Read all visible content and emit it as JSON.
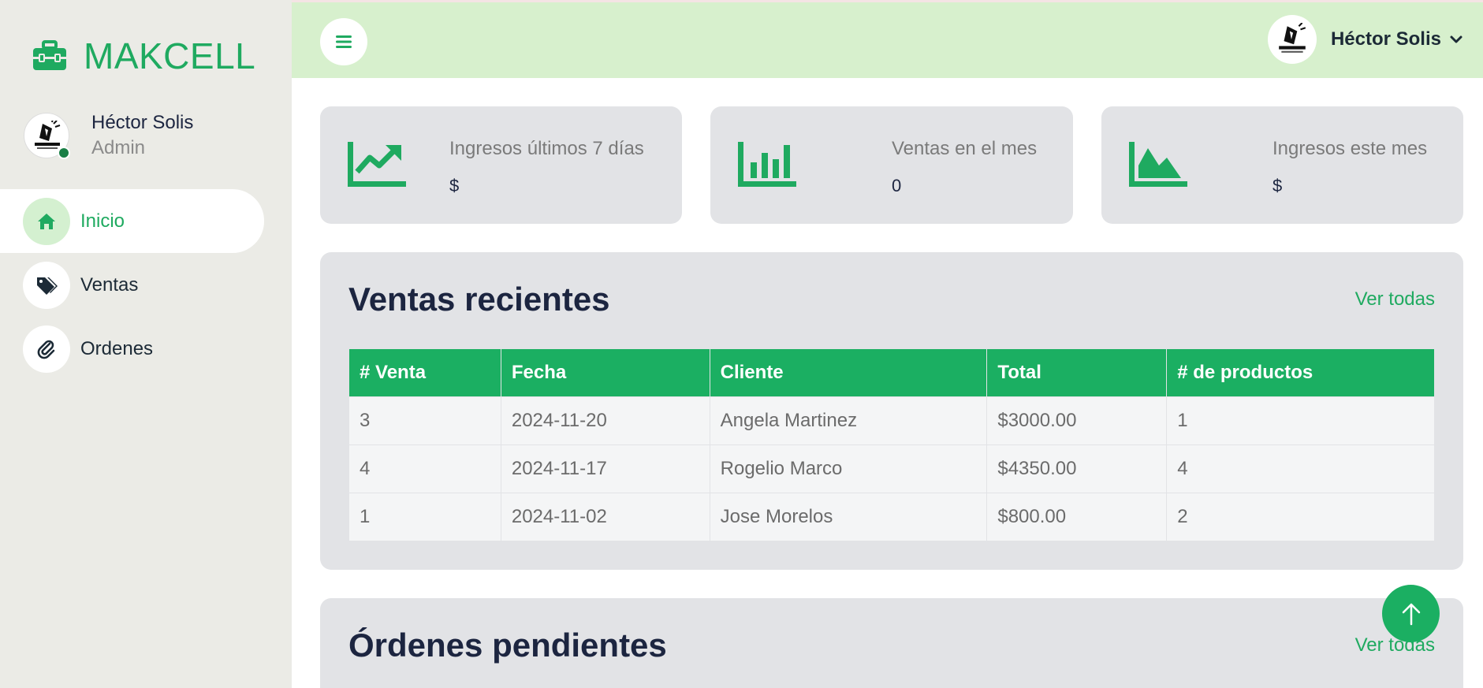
{
  "brand": {
    "name": "MAKCELL"
  },
  "sidebar": {
    "user": {
      "name": "Héctor Solis",
      "role": "Admin"
    },
    "items": [
      {
        "label": "Inicio",
        "icon": "home-icon",
        "active": true
      },
      {
        "label": "Ventas",
        "icon": "tags-icon",
        "active": false
      },
      {
        "label": "Ordenes",
        "icon": "paperclip-icon",
        "active": false
      }
    ]
  },
  "topbar": {
    "user_name": "Héctor Solis"
  },
  "stats": [
    {
      "title": "Ingresos últimos 7 días",
      "value": "$",
      "icon": "trending-chart-icon"
    },
    {
      "title": "Ventas en el mes",
      "value": "0",
      "icon": "bar-chart-icon"
    },
    {
      "title": "Ingresos este mes",
      "value": "$",
      "icon": "area-chart-icon"
    }
  ],
  "recent_sales": {
    "title": "Ventas recientes",
    "link": "Ver todas",
    "columns": [
      "# Venta",
      "Fecha",
      "Cliente",
      "Total",
      "# de productos"
    ],
    "rows": [
      [
        "3",
        "2024-11-20",
        "Angela Martinez",
        "$3000.00",
        "1"
      ],
      [
        "4",
        "2024-11-17",
        "Rogelio Marco",
        "$4350.00",
        "4"
      ],
      [
        "1",
        "2024-11-02",
        "Jose Morelos",
        "$800.00",
        "2"
      ]
    ]
  },
  "pending_orders": {
    "title": "Órdenes pendientes",
    "link": "Ver todas"
  },
  "colors": {
    "accent": "#1faa60",
    "topbar": "#d7f0cd",
    "sidebar": "#ebebe6",
    "card": "#e2e3e6"
  }
}
